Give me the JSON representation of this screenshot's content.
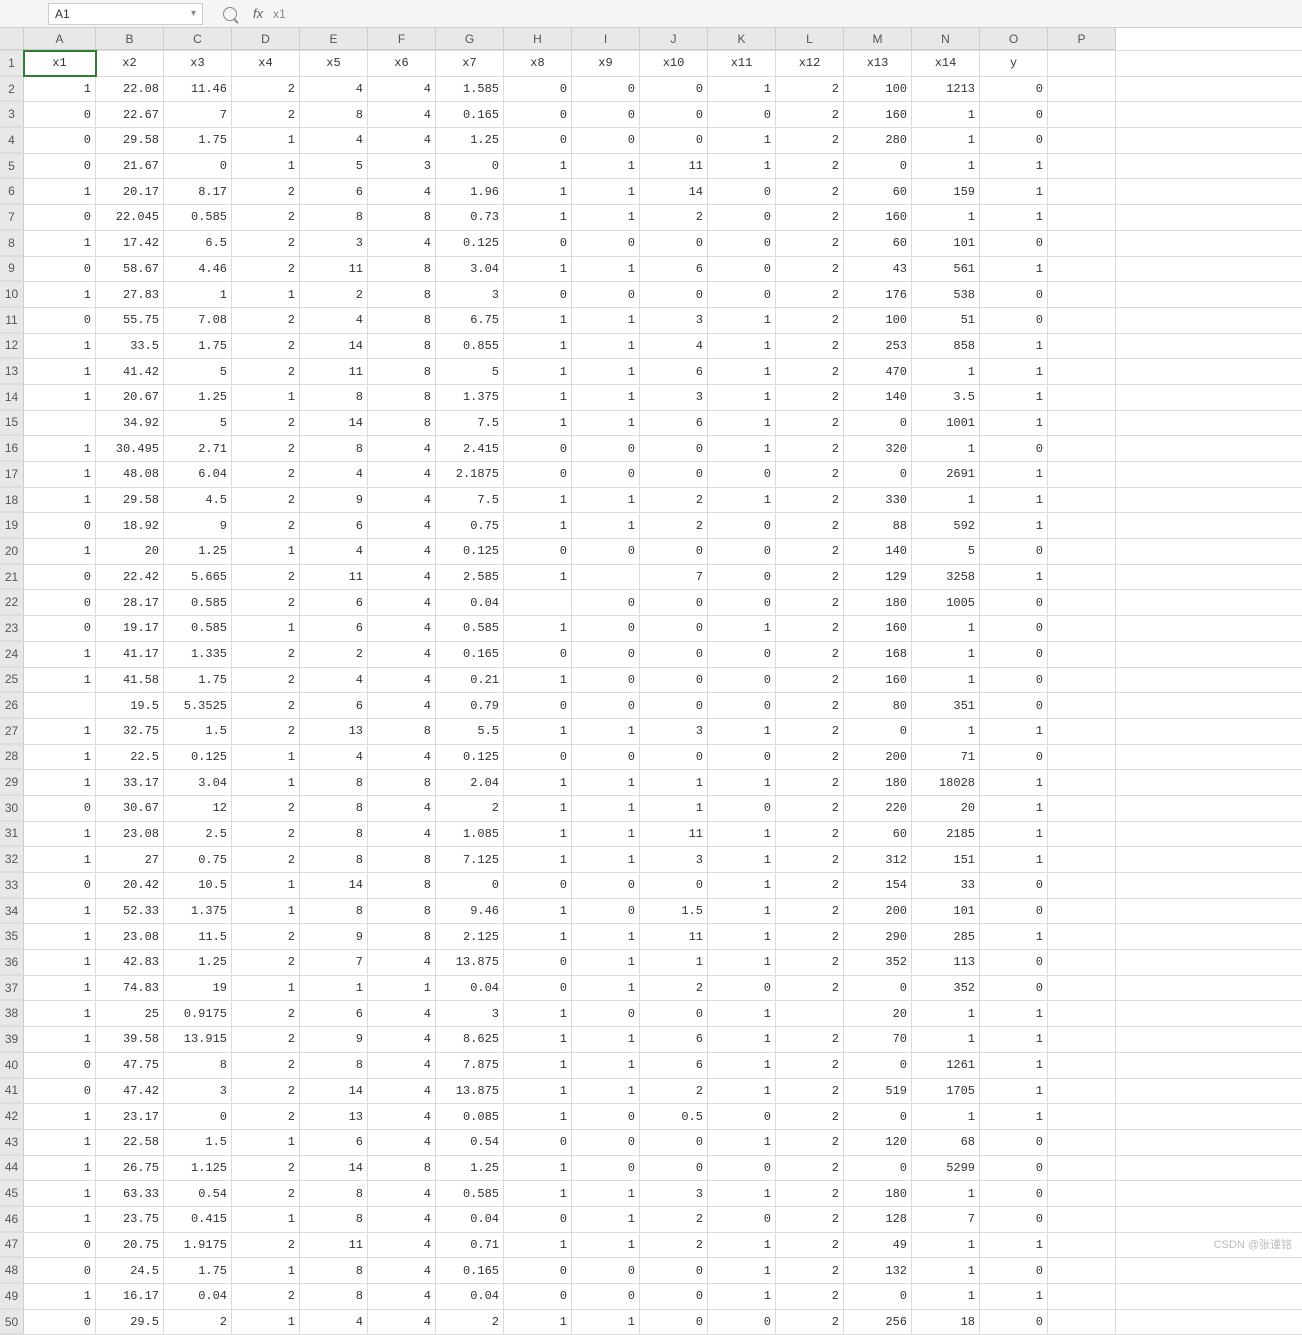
{
  "nameBox": "A1",
  "formulaValue": "x1",
  "watermark": "CSDN @张谨铭",
  "colLetters": [
    "A",
    "B",
    "C",
    "D",
    "E",
    "F",
    "G",
    "H",
    "I",
    "J",
    "K",
    "L",
    "M",
    "N",
    "O",
    "P"
  ],
  "colClasses": [
    "cA",
    "cB",
    "cC",
    "cD",
    "cE",
    "cF",
    "cG",
    "cH",
    "cI",
    "cJ",
    "cK",
    "cL",
    "cM",
    "cN",
    "cO",
    "cP"
  ],
  "rowNumbers": [
    "1",
    "2",
    "3",
    "4",
    "5",
    "6",
    "7",
    "8",
    "9",
    "10",
    "11",
    "12",
    "13",
    "14",
    "15",
    "16",
    "17",
    "18",
    "19",
    "20",
    "21",
    "22",
    "23",
    "24",
    "25",
    "26",
    "27",
    "28",
    "29",
    "30",
    "31",
    "32",
    "33",
    "34",
    "35",
    "36",
    "37",
    "38",
    "39",
    "40",
    "41",
    "42",
    "43",
    "44",
    "45",
    "46",
    "47",
    "48",
    "49",
    "50"
  ],
  "headers": [
    "x1",
    "x2",
    "x3",
    "x4",
    "x5",
    "x6",
    "x7",
    "x8",
    "x9",
    "x10",
    "x11",
    "x12",
    "x13",
    "x14",
    "y",
    ""
  ],
  "rows": [
    [
      "1",
      "22.08",
      "11.46",
      "2",
      "4",
      "4",
      "1.585",
      "0",
      "0",
      "0",
      "1",
      "2",
      "100",
      "1213",
      "0",
      ""
    ],
    [
      "0",
      "22.67",
      "7",
      "2",
      "8",
      "4",
      "0.165",
      "0",
      "0",
      "0",
      "0",
      "2",
      "160",
      "1",
      "0",
      ""
    ],
    [
      "0",
      "29.58",
      "1.75",
      "1",
      "4",
      "4",
      "1.25",
      "0",
      "0",
      "0",
      "1",
      "2",
      "280",
      "1",
      "0",
      ""
    ],
    [
      "0",
      "21.67",
      "0",
      "1",
      "5",
      "3",
      "0",
      "1",
      "1",
      "11",
      "1",
      "2",
      "0",
      "1",
      "1",
      ""
    ],
    [
      "1",
      "20.17",
      "8.17",
      "2",
      "6",
      "4",
      "1.96",
      "1",
      "1",
      "14",
      "0",
      "2",
      "60",
      "159",
      "1",
      ""
    ],
    [
      "0",
      "22.045",
      "0.585",
      "2",
      "8",
      "8",
      "0.73",
      "1",
      "1",
      "2",
      "0",
      "2",
      "160",
      "1",
      "1",
      ""
    ],
    [
      "1",
      "17.42",
      "6.5",
      "2",
      "3",
      "4",
      "0.125",
      "0",
      "0",
      "0",
      "0",
      "2",
      "60",
      "101",
      "0",
      ""
    ],
    [
      "0",
      "58.67",
      "4.46",
      "2",
      "11",
      "8",
      "3.04",
      "1",
      "1",
      "6",
      "0",
      "2",
      "43",
      "561",
      "1",
      ""
    ],
    [
      "1",
      "27.83",
      "1",
      "1",
      "2",
      "8",
      "3",
      "0",
      "0",
      "0",
      "0",
      "2",
      "176",
      "538",
      "0",
      ""
    ],
    [
      "0",
      "55.75",
      "7.08",
      "2",
      "4",
      "8",
      "6.75",
      "1",
      "1",
      "3",
      "1",
      "2",
      "100",
      "51",
      "0",
      ""
    ],
    [
      "1",
      "33.5",
      "1.75",
      "2",
      "14",
      "8",
      "0.855",
      "1",
      "1",
      "4",
      "1",
      "2",
      "253",
      "858",
      "1",
      ""
    ],
    [
      "1",
      "41.42",
      "5",
      "2",
      "11",
      "8",
      "5",
      "1",
      "1",
      "6",
      "1",
      "2",
      "470",
      "1",
      "1",
      ""
    ],
    [
      "1",
      "20.67",
      "1.25",
      "1",
      "8",
      "8",
      "1.375",
      "1",
      "1",
      "3",
      "1",
      "2",
      "140",
      "3.5",
      "1",
      ""
    ],
    [
      "",
      "34.92",
      "5",
      "2",
      "14",
      "8",
      "7.5",
      "1",
      "1",
      "6",
      "1",
      "2",
      "0",
      "1001",
      "1",
      ""
    ],
    [
      "1",
      "30.495",
      "2.71",
      "2",
      "8",
      "4",
      "2.415",
      "0",
      "0",
      "0",
      "1",
      "2",
      "320",
      "1",
      "0",
      ""
    ],
    [
      "1",
      "48.08",
      "6.04",
      "2",
      "4",
      "4",
      "2.1875",
      "0",
      "0",
      "0",
      "0",
      "2",
      "0",
      "2691",
      "1",
      ""
    ],
    [
      "1",
      "29.58",
      "4.5",
      "2",
      "9",
      "4",
      "7.5",
      "1",
      "1",
      "2",
      "1",
      "2",
      "330",
      "1",
      "1",
      ""
    ],
    [
      "0",
      "18.92",
      "9",
      "2",
      "6",
      "4",
      "0.75",
      "1",
      "1",
      "2",
      "0",
      "2",
      "88",
      "592",
      "1",
      ""
    ],
    [
      "1",
      "20",
      "1.25",
      "1",
      "4",
      "4",
      "0.125",
      "0",
      "0",
      "0",
      "0",
      "2",
      "140",
      "5",
      "0",
      ""
    ],
    [
      "0",
      "22.42",
      "5.665",
      "2",
      "11",
      "4",
      "2.585",
      "1",
      "",
      "7",
      "0",
      "2",
      "129",
      "3258",
      "1",
      ""
    ],
    [
      "0",
      "28.17",
      "0.585",
      "2",
      "6",
      "4",
      "0.04",
      "",
      "0",
      "0",
      "0",
      "2",
      "180",
      "1005",
      "0",
      ""
    ],
    [
      "0",
      "19.17",
      "0.585",
      "1",
      "6",
      "4",
      "0.585",
      "1",
      "0",
      "0",
      "1",
      "2",
      "160",
      "1",
      "0",
      ""
    ],
    [
      "1",
      "41.17",
      "1.335",
      "2",
      "2",
      "4",
      "0.165",
      "0",
      "0",
      "0",
      "0",
      "2",
      "168",
      "1",
      "0",
      ""
    ],
    [
      "1",
      "41.58",
      "1.75",
      "2",
      "4",
      "4",
      "0.21",
      "1",
      "0",
      "0",
      "0",
      "2",
      "160",
      "1",
      "0",
      ""
    ],
    [
      "",
      "19.5",
      "5.3525",
      "2",
      "6",
      "4",
      "0.79",
      "0",
      "0",
      "0",
      "0",
      "2",
      "80",
      "351",
      "0",
      ""
    ],
    [
      "1",
      "32.75",
      "1.5",
      "2",
      "13",
      "8",
      "5.5",
      "1",
      "1",
      "3",
      "1",
      "2",
      "0",
      "1",
      "1",
      ""
    ],
    [
      "1",
      "22.5",
      "0.125",
      "1",
      "4",
      "4",
      "0.125",
      "0",
      "0",
      "0",
      "0",
      "2",
      "200",
      "71",
      "0",
      ""
    ],
    [
      "1",
      "33.17",
      "3.04",
      "1",
      "8",
      "8",
      "2.04",
      "1",
      "1",
      "1",
      "1",
      "2",
      "180",
      "18028",
      "1",
      ""
    ],
    [
      "0",
      "30.67",
      "12",
      "2",
      "8",
      "4",
      "2",
      "1",
      "1",
      "1",
      "0",
      "2",
      "220",
      "20",
      "1",
      ""
    ],
    [
      "1",
      "23.08",
      "2.5",
      "2",
      "8",
      "4",
      "1.085",
      "1",
      "1",
      "11",
      "1",
      "2",
      "60",
      "2185",
      "1",
      ""
    ],
    [
      "1",
      "27",
      "0.75",
      "2",
      "8",
      "8",
      "7.125",
      "1",
      "1",
      "3",
      "1",
      "2",
      "312",
      "151",
      "1",
      ""
    ],
    [
      "0",
      "20.42",
      "10.5",
      "1",
      "14",
      "8",
      "0",
      "0",
      "0",
      "0",
      "1",
      "2",
      "154",
      "33",
      "0",
      ""
    ],
    [
      "1",
      "52.33",
      "1.375",
      "1",
      "8",
      "8",
      "9.46",
      "1",
      "0",
      "1.5",
      "1",
      "2",
      "200",
      "101",
      "0",
      ""
    ],
    [
      "1",
      "23.08",
      "11.5",
      "2",
      "9",
      "8",
      "2.125",
      "1",
      "1",
      "11",
      "1",
      "2",
      "290",
      "285",
      "1",
      ""
    ],
    [
      "1",
      "42.83",
      "1.25",
      "2",
      "7",
      "4",
      "13.875",
      "0",
      "1",
      "1",
      "1",
      "2",
      "352",
      "113",
      "0",
      ""
    ],
    [
      "1",
      "74.83",
      "19",
      "1",
      "1",
      "1",
      "0.04",
      "0",
      "1",
      "2",
      "0",
      "2",
      "0",
      "352",
      "0",
      ""
    ],
    [
      "1",
      "25",
      "0.9175",
      "2",
      "6",
      "4",
      "3",
      "1",
      "0",
      "0",
      "1",
      "",
      "20",
      "1",
      "1",
      ""
    ],
    [
      "1",
      "39.58",
      "13.915",
      "2",
      "9",
      "4",
      "8.625",
      "1",
      "1",
      "6",
      "1",
      "2",
      "70",
      "1",
      "1",
      ""
    ],
    [
      "0",
      "47.75",
      "8",
      "2",
      "8",
      "4",
      "7.875",
      "1",
      "1",
      "6",
      "1",
      "2",
      "0",
      "1261",
      "1",
      ""
    ],
    [
      "0",
      "47.42",
      "3",
      "2",
      "14",
      "4",
      "13.875",
      "1",
      "1",
      "2",
      "1",
      "2",
      "519",
      "1705",
      "1",
      ""
    ],
    [
      "1",
      "23.17",
      "0",
      "2",
      "13",
      "4",
      "0.085",
      "1",
      "0",
      "0.5",
      "0",
      "2",
      "0",
      "1",
      "1",
      ""
    ],
    [
      "1",
      "22.58",
      "1.5",
      "1",
      "6",
      "4",
      "0.54",
      "0",
      "0",
      "0",
      "1",
      "2",
      "120",
      "68",
      "0",
      ""
    ],
    [
      "1",
      "26.75",
      "1.125",
      "2",
      "14",
      "8",
      "1.25",
      "1",
      "0",
      "0",
      "0",
      "2",
      "0",
      "5299",
      "0",
      ""
    ],
    [
      "1",
      "63.33",
      "0.54",
      "2",
      "8",
      "4",
      "0.585",
      "1",
      "1",
      "3",
      "1",
      "2",
      "180",
      "1",
      "0",
      ""
    ],
    [
      "1",
      "23.75",
      "0.415",
      "1",
      "8",
      "4",
      "0.04",
      "0",
      "1",
      "2",
      "0",
      "2",
      "128",
      "7",
      "0",
      ""
    ],
    [
      "0",
      "20.75",
      "1.9175",
      "2",
      "11",
      "4",
      "0.71",
      "1",
      "1",
      "2",
      "1",
      "2",
      "49",
      "1",
      "1",
      ""
    ],
    [
      "0",
      "24.5",
      "1.75",
      "1",
      "8",
      "4",
      "0.165",
      "0",
      "0",
      "0",
      "1",
      "2",
      "132",
      "1",
      "0",
      ""
    ],
    [
      "1",
      "16.17",
      "0.04",
      "2",
      "8",
      "4",
      "0.04",
      "0",
      "0",
      "0",
      "1",
      "2",
      "0",
      "1",
      "1",
      ""
    ],
    [
      "0",
      "29.5",
      "2",
      "1",
      "4",
      "4",
      "2",
      "1",
      "1",
      "0",
      "0",
      "2",
      "256",
      "18",
      "0",
      ""
    ]
  ]
}
